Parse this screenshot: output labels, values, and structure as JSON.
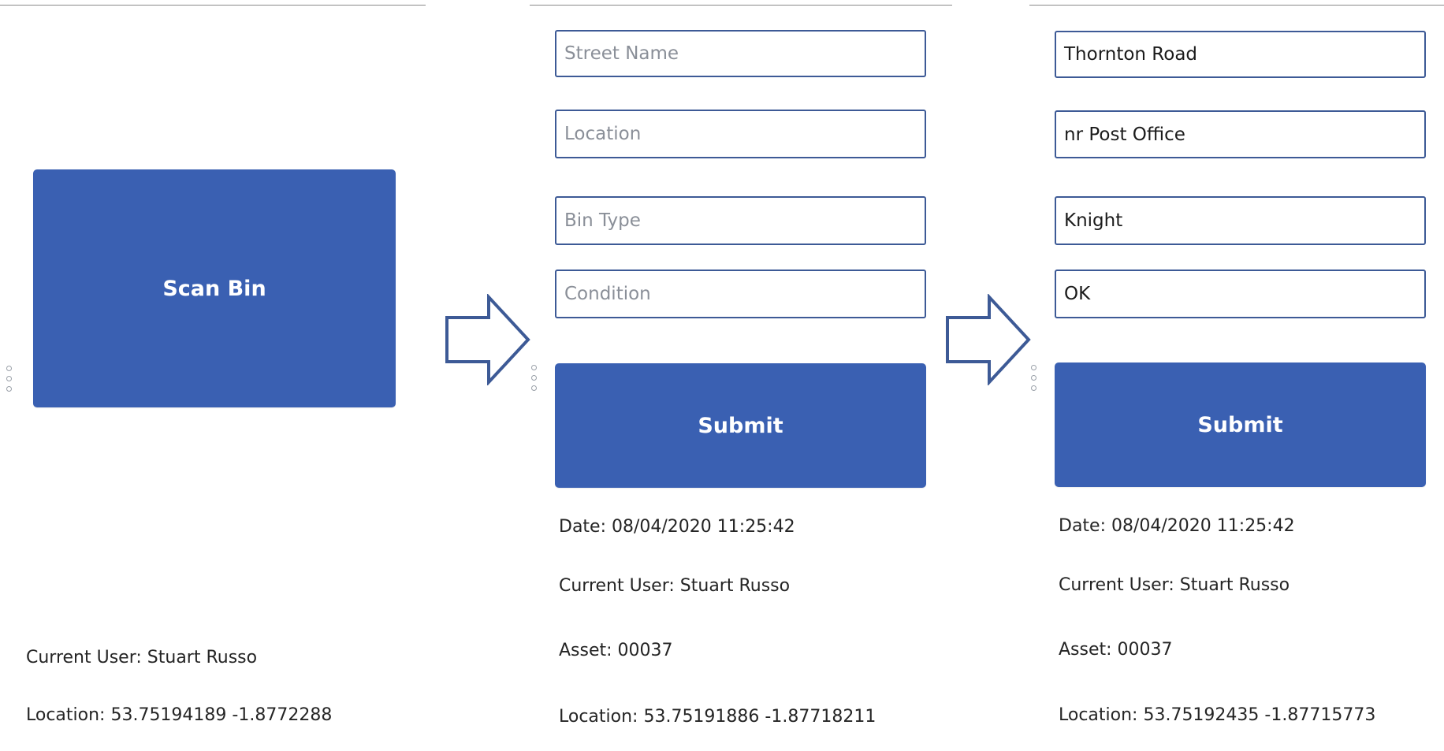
{
  "screen1": {
    "scan_button": "Scan Bin",
    "current_user": "Current User: Stuart Russo",
    "location": "Location: 53.75194189 -1.8772288"
  },
  "screen2": {
    "street_placeholder": "Street Name",
    "location_placeholder": "Location",
    "bin_type_placeholder": "Bin Type",
    "condition_placeholder": "Condition",
    "submit_label": "Submit",
    "date": "Date: 08/04/2020 11:25:42",
    "current_user": "Current User: Stuart Russo",
    "asset": "Asset: 00037",
    "location": "Location: 53.75191886 -1.87718211"
  },
  "screen3": {
    "street_value": "Thornton Road",
    "location_value": "nr Post Office",
    "bin_type_value": "Knight",
    "condition_value": "OK",
    "submit_label": "Submit",
    "date": "Date: 08/04/2020 11:25:42",
    "current_user": "Current User: Stuart Russo",
    "asset": "Asset: 00037",
    "location": "Location: 53.75192435 -1.87715773"
  },
  "colors": {
    "button_blue": "#3a60b2",
    "field_border": "#3d5a96",
    "arrow_stroke": "#3d5a96"
  },
  "icons": [
    "right-arrow-icon",
    "drag-handle-icon"
  ]
}
